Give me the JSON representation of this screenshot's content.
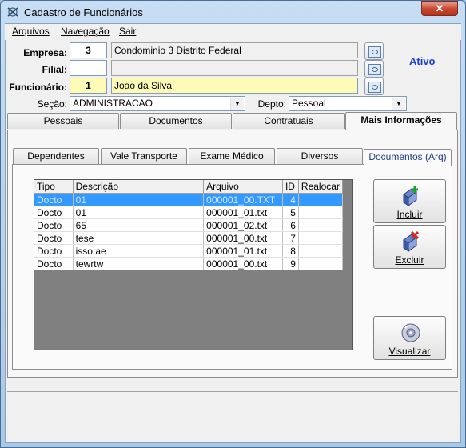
{
  "window": {
    "title": "Cadastro de Funcionários",
    "close_glyph": "✕"
  },
  "menu": [
    "Arquivos",
    "Navegação",
    "Sair"
  ],
  "header": {
    "empresa_label": "Empresa:",
    "empresa_code": "3",
    "empresa_name": "Condominio 3 Distrito Federal",
    "filial_label": "Filial:",
    "filial_code": "",
    "filial_name": "",
    "funcionario_label": "Funcionário:",
    "funcionario_code": "1",
    "funcionario_name": "Joao da Silva",
    "status": "Ativo",
    "secao_label": "Seção:",
    "secao_value": "ADMINISTRACAO",
    "depto_label": "Depto:",
    "depto_value": "Pessoal"
  },
  "main_tabs": [
    {
      "label": "Pessoais",
      "active": false
    },
    {
      "label": "Documentos",
      "active": false
    },
    {
      "label": "Contratuais",
      "active": false
    },
    {
      "label": "Mais Informações",
      "active": true
    }
  ],
  "sub_tabs": [
    {
      "label": "Dependentes",
      "active": false
    },
    {
      "label": "Vale Transporte",
      "active": false
    },
    {
      "label": "Exame Médico",
      "active": false
    },
    {
      "label": "Diversos",
      "active": false
    },
    {
      "label": "Documentos (Arq)",
      "active": true
    }
  ],
  "table": {
    "columns": [
      "Tipo",
      "Descrição",
      "Arquivo",
      "ID",
      "Realocar"
    ],
    "rows": [
      {
        "tipo": "Docto",
        "descricao": "01",
        "arquivo": "000001_00.TXT",
        "id": "4",
        "realocar": "",
        "selected": true
      },
      {
        "tipo": "Docto",
        "descricao": "01",
        "arquivo": "000001_01.txt",
        "id": "5",
        "realocar": "",
        "selected": false
      },
      {
        "tipo": "Docto",
        "descricao": "65",
        "arquivo": "000001_02.txt",
        "id": "6",
        "realocar": "",
        "selected": false
      },
      {
        "tipo": "Docto",
        "descricao": "tese",
        "arquivo": "000001_00.txt",
        "id": "7",
        "realocar": "",
        "selected": false
      },
      {
        "tipo": "Docto",
        "descricao": "isso ae",
        "arquivo": "000001_01.txt",
        "id": "8",
        "realocar": "",
        "selected": false
      },
      {
        "tipo": "Docto",
        "descricao": "tewrtw",
        "arquivo": "000001_00.txt",
        "id": "9",
        "realocar": "",
        "selected": false
      }
    ]
  },
  "buttons": {
    "incluir": "Incluir",
    "excluir": "Excluir",
    "visualizar": "Visualizar"
  },
  "colors": {
    "accent_status": "#1d3fcf",
    "selection": "#3399ff",
    "required_field": "#fdfbb5"
  }
}
